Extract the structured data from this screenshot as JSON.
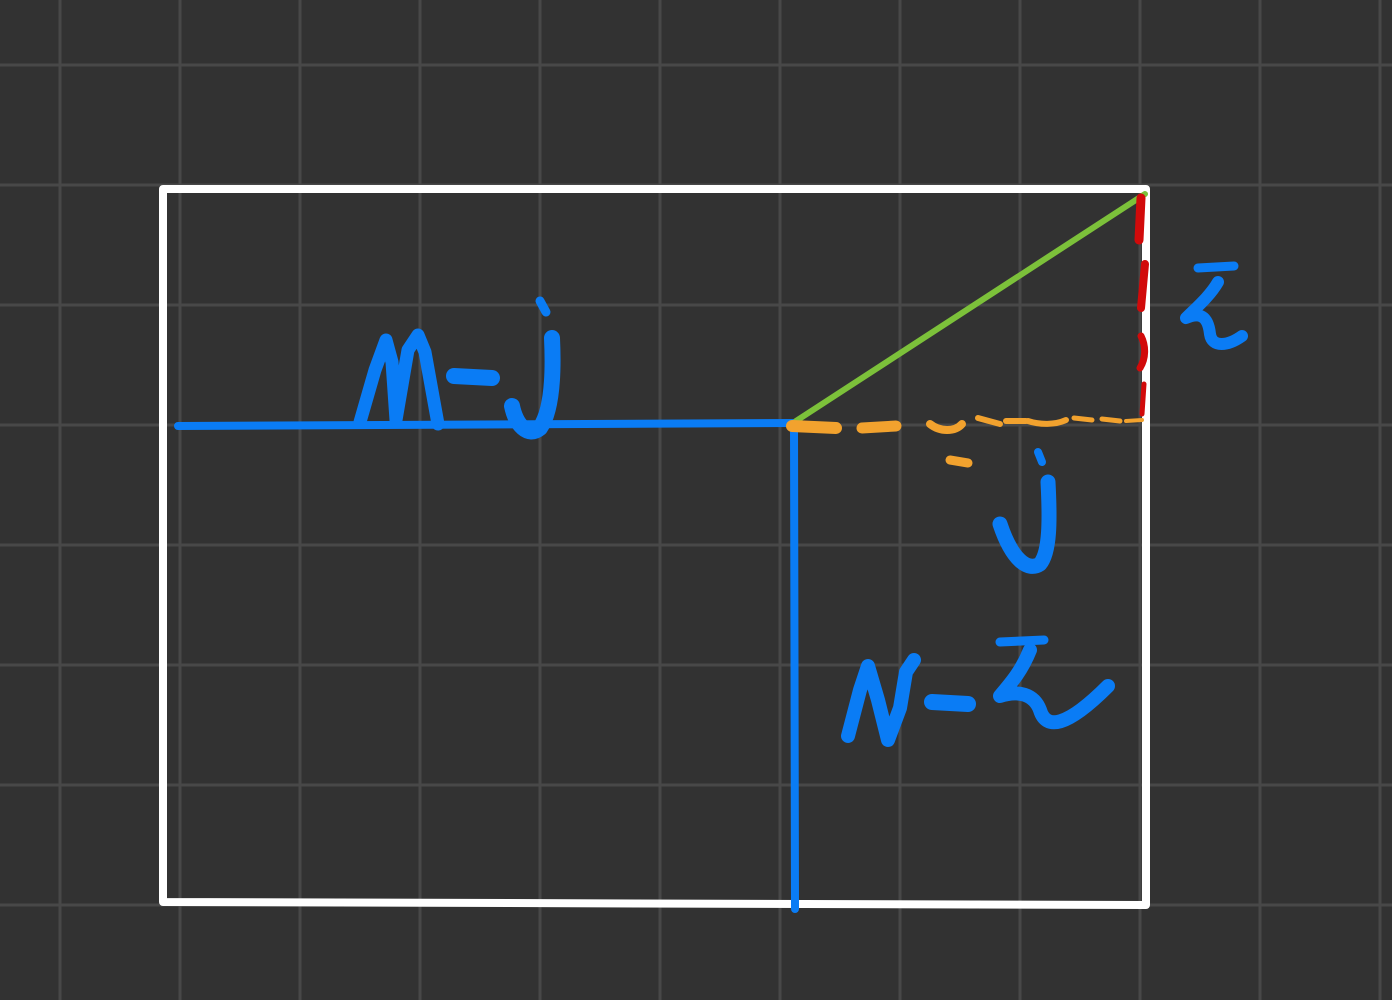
{
  "colors": {
    "background": "#323232",
    "grid": "#484848",
    "frame": "#ffffff",
    "blue_ink": "#0a7cf5",
    "green_ink": "#7cc13a",
    "orange_ink": "#f2a22e",
    "red_ink": "#d10a0a"
  },
  "labels": {
    "top_left_segment": "M-j",
    "bottom_right_segment": "N-i",
    "orange_dashed": "j",
    "red_dashed": "i"
  }
}
